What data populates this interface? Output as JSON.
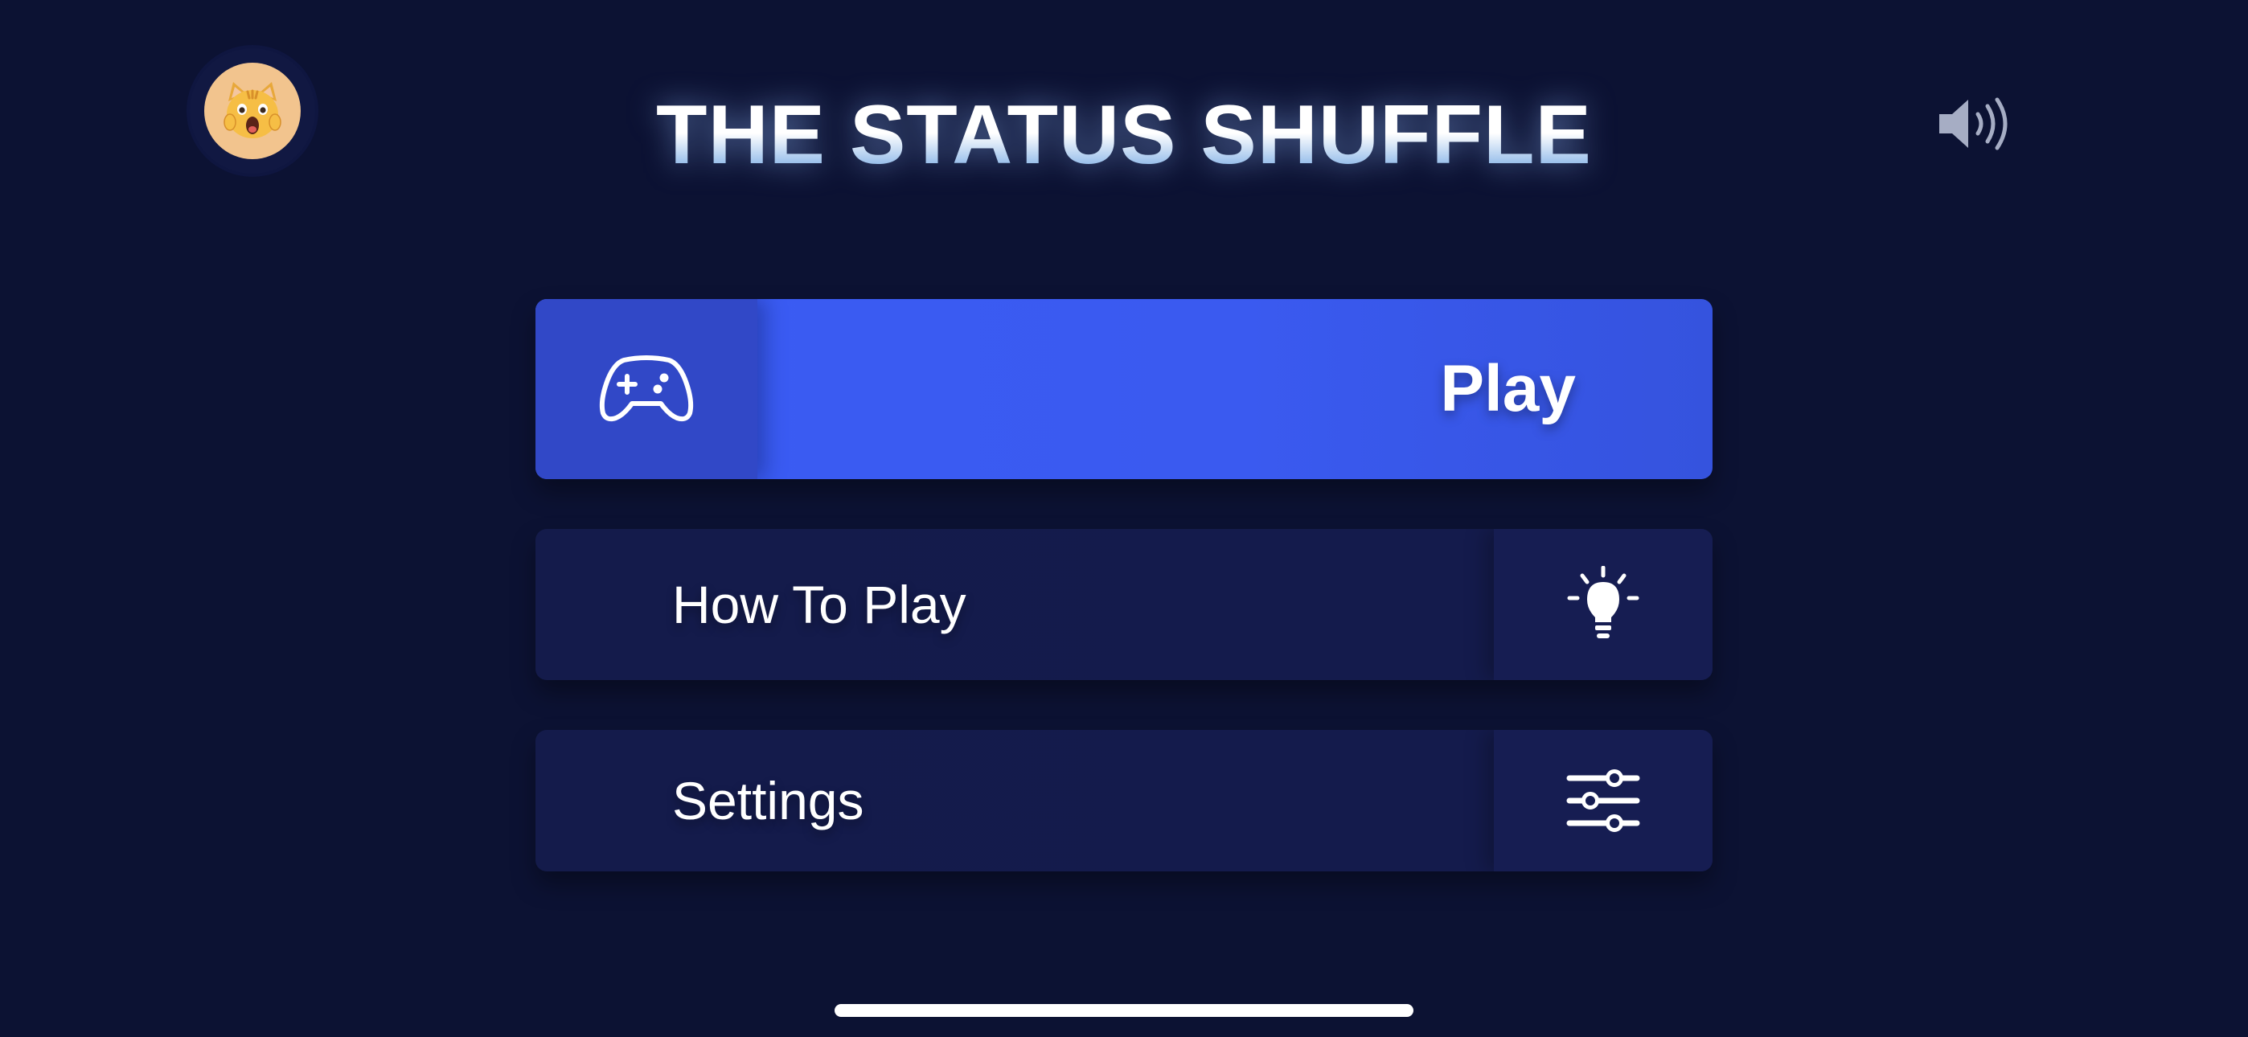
{
  "app": {
    "title": "THE STATUS SHUFFLE"
  },
  "header": {
    "avatar_emoji": "🙀",
    "avatar_icon": "shocked-cat-face-icon",
    "sound_icon": "speaker-volume-icon"
  },
  "menu": {
    "play": {
      "label": "Play",
      "icon": "game-controller-icon"
    },
    "how_to_play": {
      "label": "How To Play",
      "icon": "lightbulb-icon"
    },
    "settings": {
      "label": "Settings",
      "icon": "sliders-icon"
    }
  },
  "colors": {
    "background": "#0c1233",
    "primary": "#3a5cf4",
    "primary_icon_box": "#3148c7",
    "secondary": "#141b4b",
    "secondary_icon_box": "#161d52",
    "avatar_bg": "#f2c48e"
  }
}
